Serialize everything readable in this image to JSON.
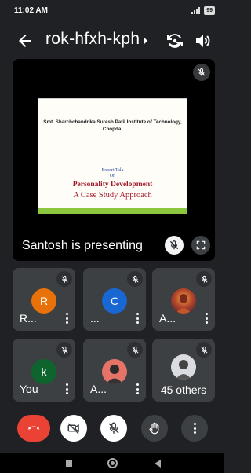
{
  "status_bar": {
    "time": "11:02 AM",
    "battery": "99"
  },
  "top_bar": {
    "meeting_code": "rok-hfxh-kph"
  },
  "stage": {
    "slide": {
      "institute": "Smt. Sharchchandrika Suresh Patil Institute of Technology, Chopda.",
      "expert_talk": "Expert Talk",
      "on": "On",
      "title": "Personality Development",
      "subtitle": "A Case Study Approach"
    },
    "presenting_label": "Santosh is presenting"
  },
  "participants": [
    {
      "name": "R...",
      "initial": "R",
      "avatar_color": "#e8710a"
    },
    {
      "name": "...",
      "initial": "C",
      "avatar_color": "#1967d2"
    },
    {
      "name": "A...",
      "initial": "",
      "avatar_color": "#8a3b1e"
    },
    {
      "name": "You",
      "initial": "k",
      "avatar_color": "#0d652d"
    },
    {
      "name": "A...",
      "initial": "",
      "avatar_color": "#e57368"
    }
  ],
  "others_tile": {
    "label": "45 others"
  },
  "controls": [
    "end-call",
    "camera-off",
    "mic-off",
    "raise-hand",
    "more-options"
  ]
}
